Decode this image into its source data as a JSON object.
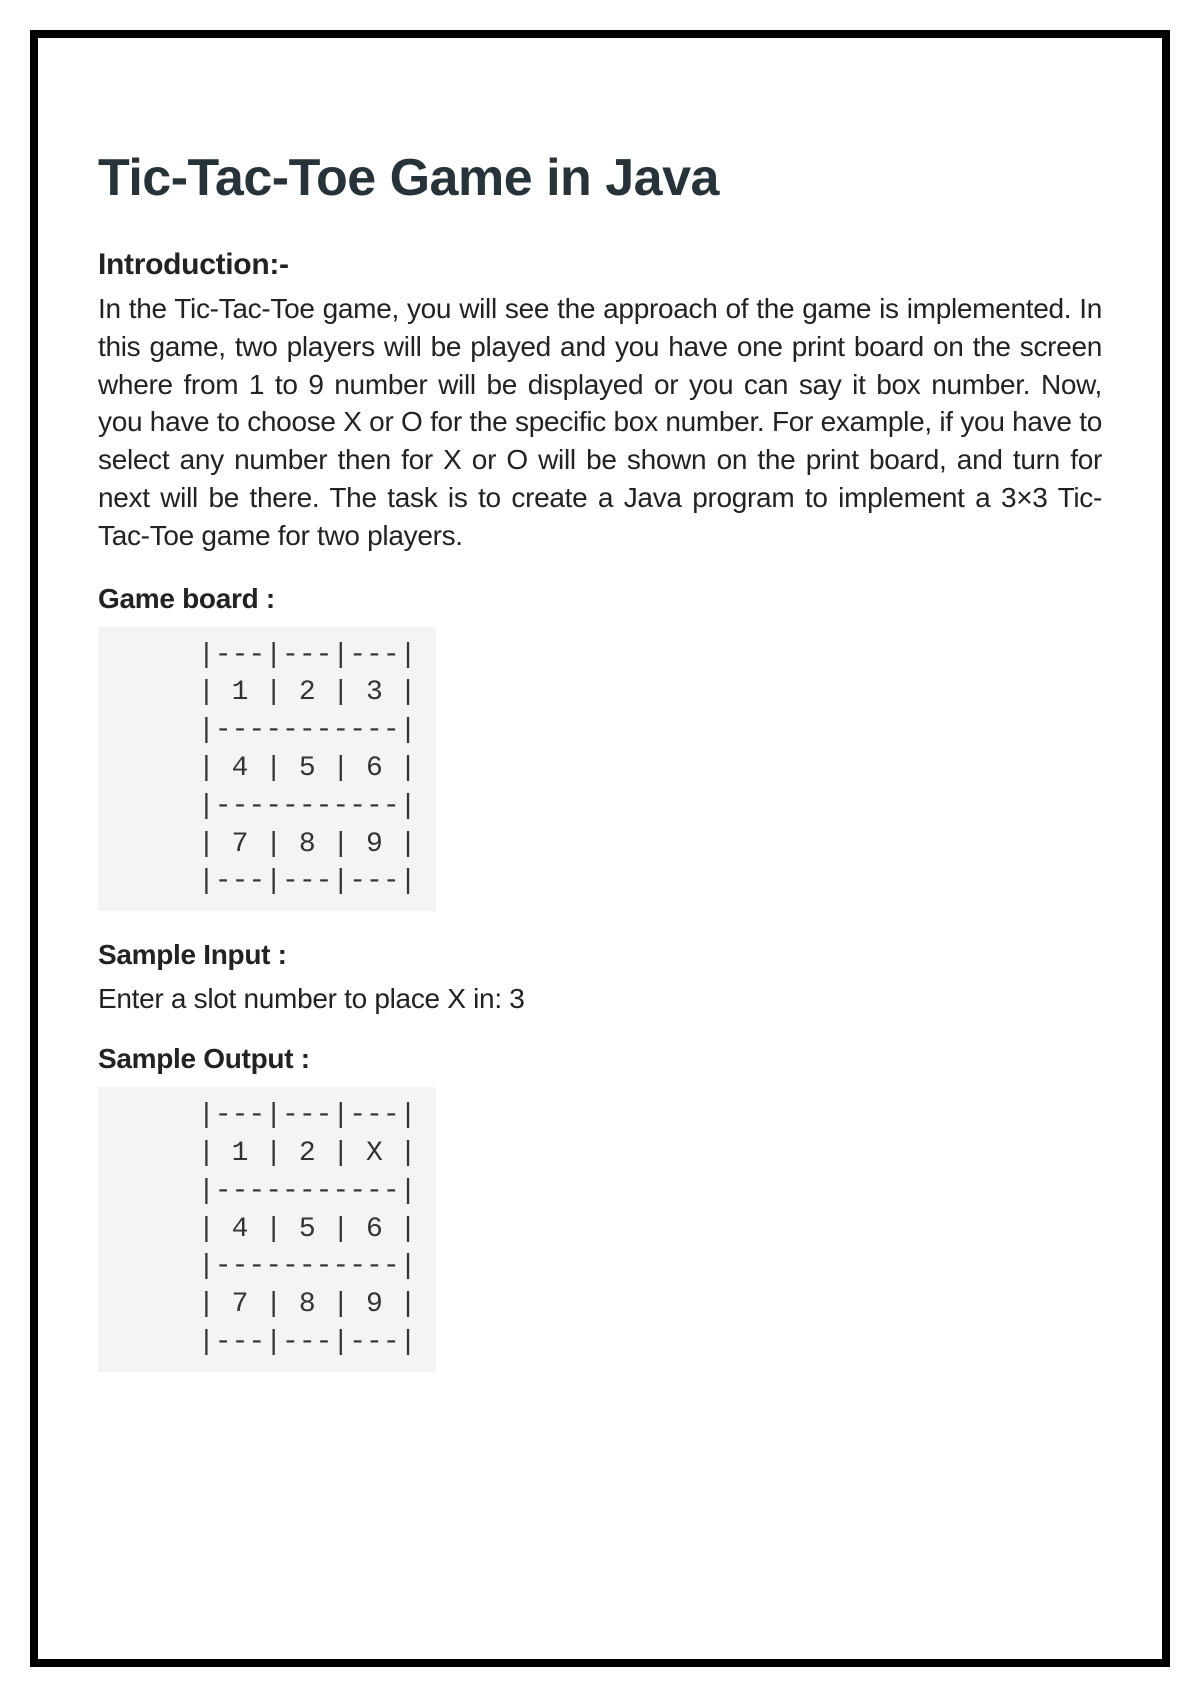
{
  "title": "Tic-Tac-Toe Game in Java",
  "introduction_heading": "Introduction:-",
  "introduction_text": "In the Tic-Tac-Toe game, you will see the approach of the game is implemented. In this game, two players will be played and you have one print board on the screen where from 1 to 9 number will be displayed or you can say it box number. Now, you have to choose X or O for the specific box number. For example, if you have to select any number then for X or O will be shown on the print board, and turn for next will be there. The task is to create a Java program to implement a 3×3 Tic-Tac-Toe game for two players.",
  "game_board_heading": "Game board :",
  "game_board_code": "|---|---|---|\n| 1 | 2 | 3 |\n|-----------|\n| 4 | 5 | 6 |\n|-----------|\n| 7 | 8 | 9 |\n|---|---|---|",
  "sample_input_heading": "Sample Input :",
  "sample_input_text": "Enter a slot number to place X in: 3",
  "sample_output_heading": "Sample Output :",
  "sample_output_code": "|---|---|---|\n| 1 | 2 | X |\n|-----------|\n| 4 | 5 | 6 |\n|-----------|\n| 7 | 8 | 9 |\n|---|---|---|"
}
